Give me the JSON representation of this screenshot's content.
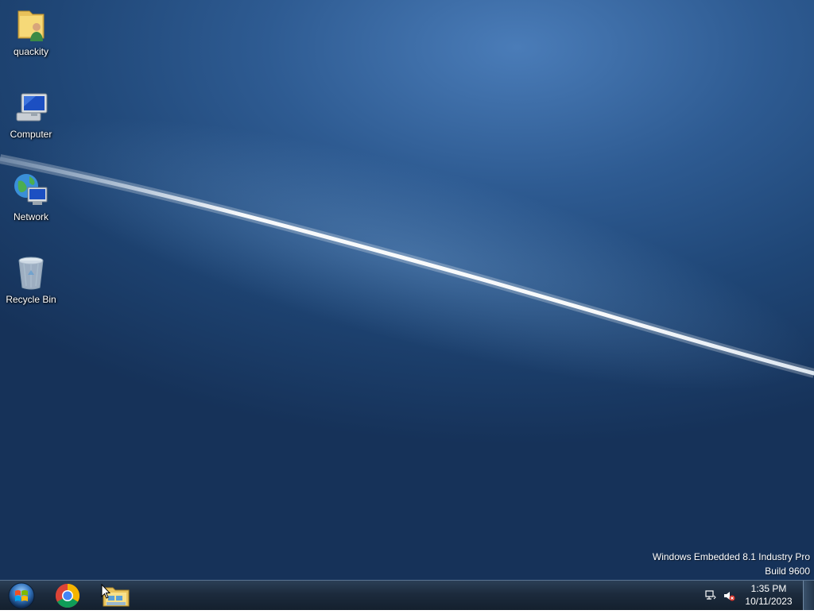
{
  "desktop": {
    "icons": [
      {
        "label": "quackity",
        "icon": "user-folder-icon"
      },
      {
        "label": "Computer",
        "icon": "computer-icon"
      },
      {
        "label": "Network",
        "icon": "network-icon"
      },
      {
        "label": "Recycle Bin",
        "icon": "recycle-bin-icon"
      }
    ],
    "watermark": {
      "line1": "Windows Embedded 8.1 Industry Pro",
      "line2": "Build 9600"
    }
  },
  "taskbar": {
    "start": {
      "icon": "windows-start-orb-icon"
    },
    "pinned": [
      {
        "icon": "chrome-icon"
      },
      {
        "icon": "file-explorer-icon"
      }
    ],
    "tray": {
      "icons": [
        "network-tray-icon",
        "volume-muted-icon"
      ],
      "time": "1:35 PM",
      "date": "10/11/2023"
    }
  },
  "colors": {
    "wallpaper": "#1f4676",
    "taskbar": "#1c2b3d",
    "text": "#ffffff"
  }
}
